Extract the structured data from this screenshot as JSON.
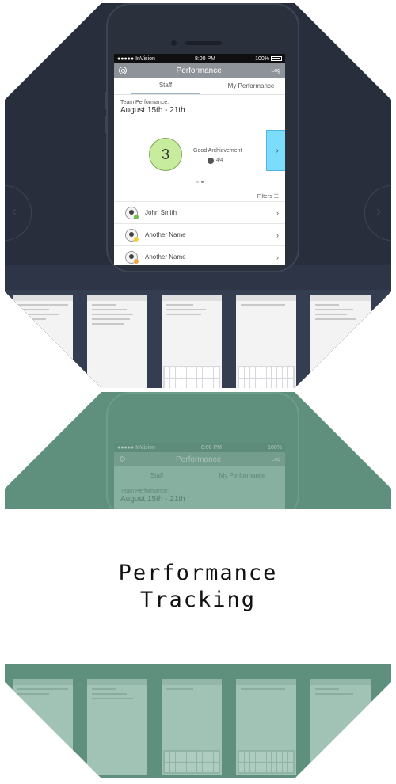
{
  "status_bar": {
    "carrier": "●●●●● InVision",
    "time": "8:00 PM",
    "battery": "100%"
  },
  "nav": {
    "title": "Performance",
    "right_label": "Log",
    "left_icon": "gear-icon"
  },
  "tabs": [
    {
      "label": "Staff",
      "active": true
    },
    {
      "label": "My Performance",
      "active": false
    }
  ],
  "team": {
    "label": "Team Performance:",
    "date_range": "August 15th - 21th"
  },
  "score": {
    "value": "3",
    "status": "Good Archievement",
    "count": "4/4",
    "circle_color": "#c8ec9d",
    "next_box_color": "#7bdcfc"
  },
  "carousel": {
    "page_index": 1,
    "page_count": 2
  },
  "filters_label": "Filters",
  "people": [
    {
      "name": "John Smith",
      "status_color": "#6cc04a"
    },
    {
      "name": "Another Name",
      "status_color": "#f1d23a"
    },
    {
      "name": "Another Name",
      "status_color": "#f3a53a"
    }
  ],
  "caption": {
    "line1": "Performance",
    "line2": "Tracking"
  },
  "colors": {
    "dark_bg": "#292e3c",
    "tint_bg": "#5f8f7d",
    "accent": "#9bb4c6"
  }
}
